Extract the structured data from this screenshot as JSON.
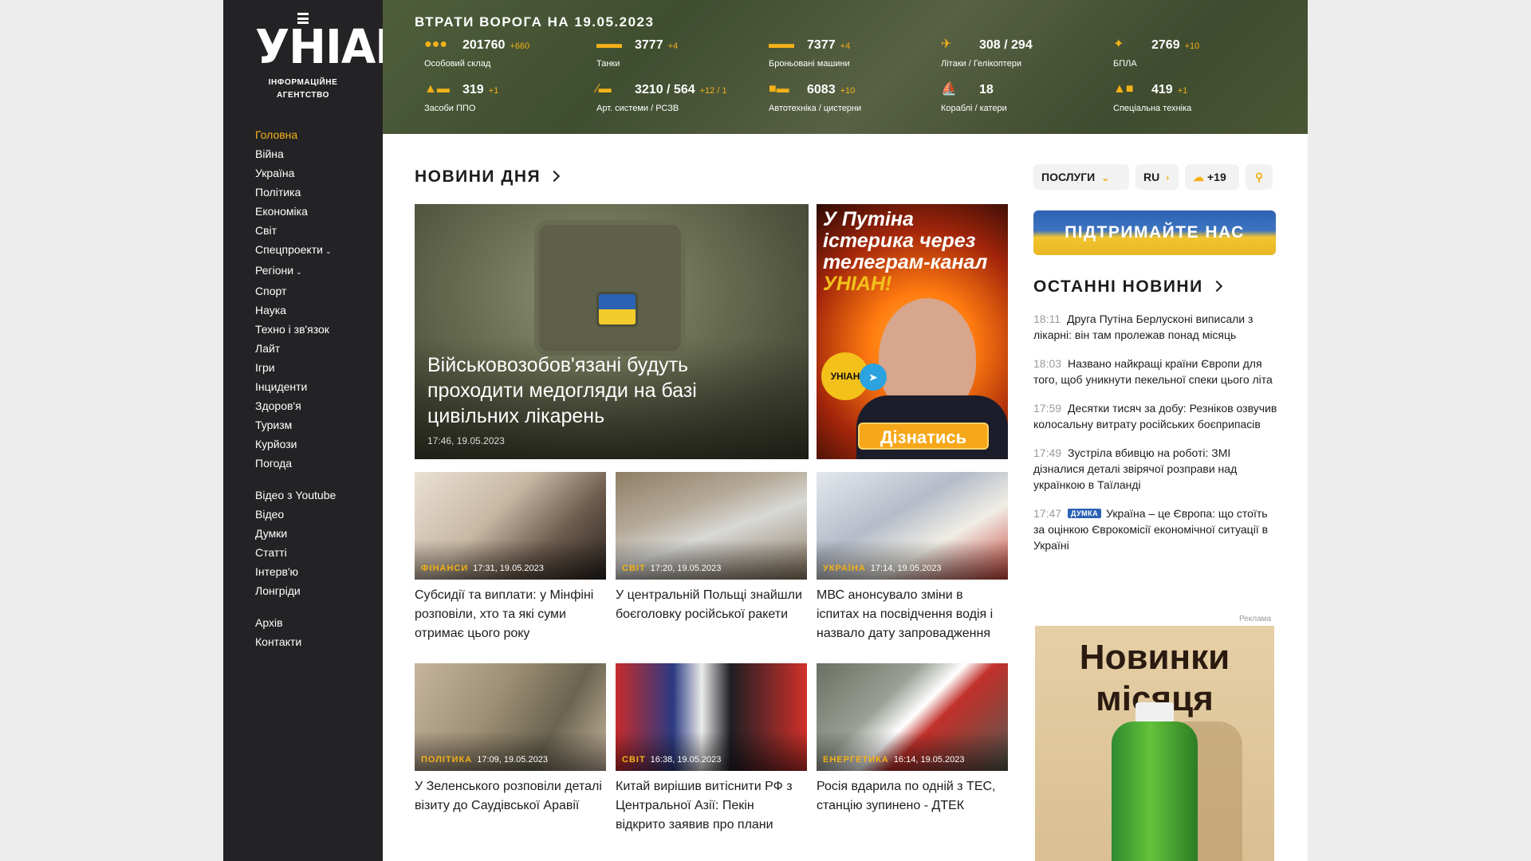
{
  "brand": {
    "logo_text": "УНІАН",
    "subtitle_line1": "ІНФОРМАЦІЙНЕ",
    "subtitle_line2": "АГЕНТСТВО"
  },
  "nav": {
    "primary": [
      "Головна",
      "Війна",
      "Україна",
      "Політика",
      "Економіка",
      "Світ",
      "Спецпроекти",
      "Регіони",
      "Спорт",
      "Наука",
      "Техно і зв'язок",
      "Лайт",
      "Ігри",
      "Інциденти",
      "Здоров'я",
      "Туризм",
      "Курйози",
      "Погода"
    ],
    "secondary": [
      "Відео з Youtube",
      "Відео",
      "Думки",
      "Статті",
      "Інтерв'ю",
      "Лонгріди"
    ],
    "tertiary": [
      "Архів",
      "Контакти"
    ]
  },
  "losses": {
    "title": "ВТРАТИ ВОРОГА НА 19.05.2023",
    "items": [
      {
        "icon": "personnel-icon",
        "value": "201760",
        "delta": "+660",
        "label": "Особовий склад"
      },
      {
        "icon": "tank-icon",
        "value": "3777",
        "delta": "+4",
        "label": "Танки"
      },
      {
        "icon": "apc-icon",
        "value": "7377",
        "delta": "+4",
        "label": "Броньовані машини"
      },
      {
        "icon": "aircraft-icon",
        "value": "308 / 294",
        "delta": "",
        "label": "Літаки / Гелікоптери"
      },
      {
        "icon": "drone-icon",
        "value": "2769",
        "delta": "+10",
        "label": "БПЛА"
      },
      {
        "icon": "air-defense-icon",
        "value": "319",
        "delta": "+1",
        "label": "Засоби ППО"
      },
      {
        "icon": "artillery-icon",
        "value": "3210 / 564",
        "delta": "+12 / 1",
        "label": "Арт. системи / РСЗВ"
      },
      {
        "icon": "truck-icon",
        "value": "6083",
        "delta": "+10",
        "label": "Автотехніка / цистерни"
      },
      {
        "icon": "ship-icon",
        "value": "18",
        "delta": "",
        "label": "Кораблі / катери"
      },
      {
        "icon": "special-equipment-icon",
        "value": "419",
        "delta": "+1",
        "label": "Спеціальна техніка"
      }
    ]
  },
  "section_news_day": "НОВИНИ ДНЯ",
  "hero": {
    "title": "Військовозобов'язані будуть проходити медогляди на базі цивільних лікарень",
    "time": "17:46, 19.05.2023"
  },
  "promo": {
    "line1": "У Путіна істерика через телеграм-канал",
    "highlight": "УНІАН!",
    "badge": "УНІАН",
    "button": "Дізнатись"
  },
  "cards": [
    {
      "category": "ФІНАНСИ",
      "time": "17:31, 19.05.2023",
      "title": "Субсидії та виплати: у Мінфіні розповіли, хто та які суми отримає цього року"
    },
    {
      "category": "СВІТ",
      "time": "17:20, 19.05.2023",
      "title": "У центральній Польщі знайшли боєголовку російської ракети"
    },
    {
      "category": "УКРАЇНА",
      "time": "17:14, 19.05.2023",
      "title": "МВС анонсувало зміни в іспитах на посвідчення водія і назвало дату запровадження"
    },
    {
      "category": "ПОЛІТИКА",
      "time": "17:09, 19.05.2023",
      "title": "У Зеленського розповіли деталі візиту до Саудівської Аравії"
    },
    {
      "category": "СВІТ",
      "time": "16:38, 19.05.2023",
      "title": "Китай вирішив витіснити РФ з Центральної Азії: Пекін відкрито заявив про плани"
    },
    {
      "category": "ЕНЕРГЕТИКА",
      "time": "16:14, 19.05.2023",
      "title": "Росія вдарила по одній з ТЕС, станцію зупинено - ДТЕК"
    }
  ],
  "header_controls": {
    "services": "ПОСЛУГИ",
    "lang": "RU",
    "weather": "+19"
  },
  "support_banner": "ПІДТРИМАЙТЕ НАС",
  "section_latest": "ОСТАННІ НОВИНИ",
  "latest": [
    {
      "time": "18:11",
      "tag": "",
      "title": "Друга Путіна Берлусконі виписали з лікарні: він там пролежав понад місяць"
    },
    {
      "time": "18:03",
      "tag": "",
      "title": "Названо найкращі країни Європи для того, щоб уникнути пекельної спеки цього літа"
    },
    {
      "time": "17:59",
      "tag": "",
      "title": "Десятки тисяч за добу: Резніков озвучив колосальну витрату російських боєприпасів"
    },
    {
      "time": "17:49",
      "tag": "",
      "title": "Зустріла вбивцю на роботі: ЗМІ дізналися деталі звірячої розправи над українкою в Таїланді"
    },
    {
      "time": "17:47",
      "tag": "ДУМКА",
      "title": "Україна – це Європа: що стоїть за оцінкою Єврокомісії економічної ситуації в Україні"
    }
  ],
  "ad": {
    "label": "Реклама",
    "title_line1": "Новинки",
    "title_line2": "місяця"
  },
  "colors": {
    "accent": "#f3b118",
    "sidebar": "#232326",
    "link_blue": "#2b62b5"
  }
}
